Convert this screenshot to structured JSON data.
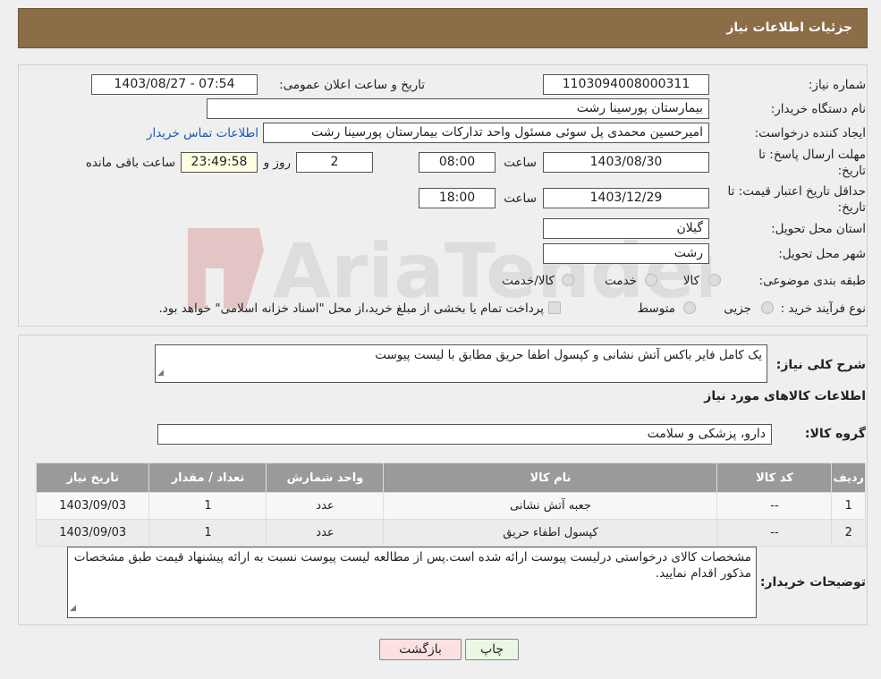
{
  "header": {
    "title": "جزئیات اطلاعات نیاز"
  },
  "watermark": {
    "text": "AriaTender.neT"
  },
  "fields": {
    "need_number_label": "شماره نیاز:",
    "need_number": "1103094008000311",
    "announce_label": "تاریخ و ساعت اعلان عمومی:",
    "announce_value": "1403/08/27 - 07:54",
    "buyer_label": "نام دستگاه خریدار:",
    "buyer_value": "بیمارستان پورسینا رشت",
    "creator_label": "ایجاد کننده درخواست:",
    "creator_value": "امیرحسین محمدی پل سوئی مسئول واحد تدارکات بیمارستان پورسینا رشت",
    "contact_link": "اطلاعات تماس خریدار",
    "deadline_label_1": "مهلت ارسال پاسخ: تا",
    "deadline_label_2": "تاریخ:",
    "deadline_date": "1403/08/30",
    "time_label": "ساعت",
    "deadline_time": "08:00",
    "days_value": "2",
    "days_label": "روز و",
    "remaining_value": "23:49:58",
    "remaining_label": "ساعت باقی مانده",
    "validity_label_1": "حداقل تاریخ اعتبار قیمت: تا",
    "validity_label_2": "تاریخ:",
    "validity_date": "1403/12/29",
    "validity_time": "18:00",
    "province_label": "استان محل تحویل:",
    "province_value": "گیلان",
    "city_label": "شهر محل تحویل:",
    "city_value": "رشت",
    "category_label": "طبقه بندی موضوعی:",
    "category_options": [
      "کالا",
      "خدمت",
      "کالا/خدمت"
    ],
    "process_label": "نوع فرآیند خرید :",
    "process_options": [
      "جزیی",
      "متوسط"
    ],
    "payment_note": "پرداخت تمام یا بخشی از مبلغ خرید،از محل \"اسناد خزانه اسلامی\" خواهد بود."
  },
  "summary": {
    "label": "شرح کلی نیاز:",
    "value": "یک کامل فایر باکس آتش نشانی و کپسول اطفا حریق مطابق با لیست پیوست"
  },
  "goods_info_title": "اطلاعات کالاهای مورد نیاز",
  "goods_group": {
    "label": "گروه کالا:",
    "value": "دارو، پزشکی و سلامت"
  },
  "table": {
    "headers": [
      "ردیف",
      "کد کالا",
      "نام کالا",
      "واحد شمارش",
      "تعداد / مقدار",
      "تاریخ نیاز"
    ],
    "rows": [
      [
        "1",
        "--",
        "جعبه آتش نشانی",
        "عدد",
        "1",
        "1403/09/03"
      ],
      [
        "2",
        "--",
        "کپسول اطفاء حریق",
        "عدد",
        "1",
        "1403/09/03"
      ]
    ]
  },
  "buyer_notes": {
    "label": "توضیحات خریدار:",
    "value": "مشخصات کالای درخواستی درلیست پیوست ارائه شده است.پس از مطالعه لیست پیوست نسبت به ارائه پیشنهاد قیمت طبق مشخصات مذکور اقدام نمایید."
  },
  "buttons": {
    "print": "چاپ",
    "back": "بازگشت"
  }
}
